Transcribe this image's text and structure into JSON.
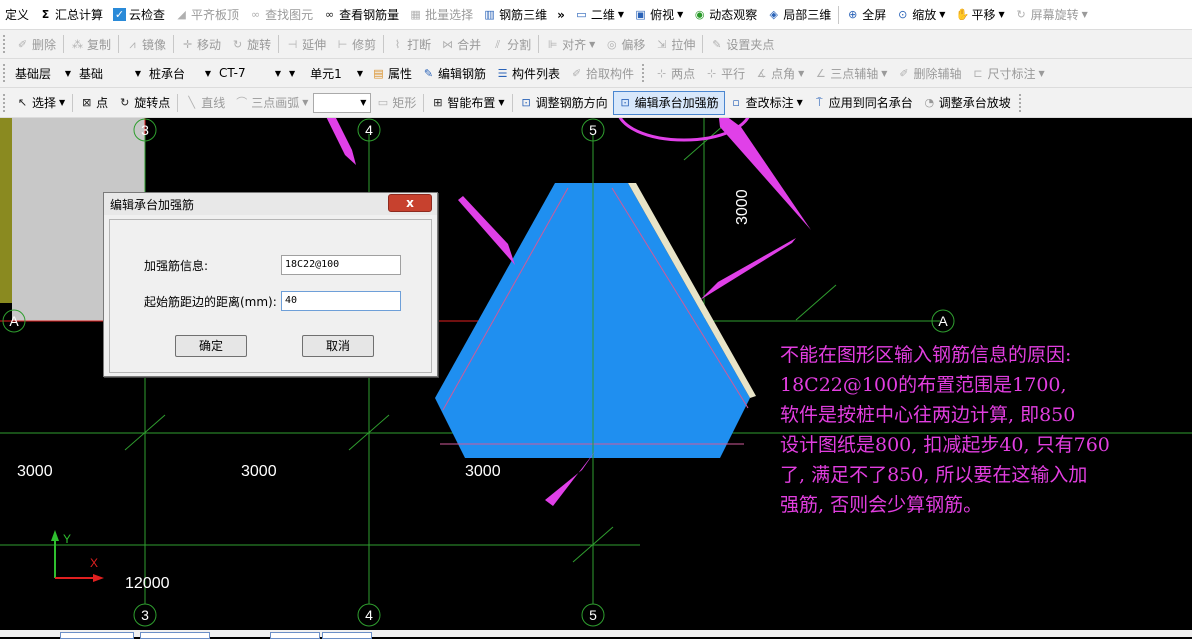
{
  "toolbar1": {
    "define": "定义",
    "sum_calc": "汇总计算",
    "cloud_check": "云检查",
    "flush_slab": "平齐板顶",
    "find_elem": "查找图元",
    "view_rebar_qty": "查看钢筋量",
    "batch_select": "批量选择",
    "rebar_3d": "钢筋三维",
    "more": "»",
    "view_2d": "二维",
    "view_top": "俯视",
    "dynamic_view": "动态观察",
    "local_3d": "局部三维",
    "fullscreen": "全屏",
    "zoom": "缩放",
    "pan": "平移",
    "screen_rotate": "屏幕旋转"
  },
  "toolbar2": {
    "delete": "删除",
    "copy": "复制",
    "mirror": "镜像",
    "move": "移动",
    "rotate": "旋转",
    "extend": "延伸",
    "trim": "修剪",
    "break": "打断",
    "merge": "合并",
    "split": "分割",
    "align": "对齐",
    "offset": "偏移",
    "stretch": "拉伸",
    "set_grip": "设置夹点"
  },
  "toolbar3": {
    "layer": "基础层",
    "category": "基础",
    "type": "桩承台",
    "name": "CT-7",
    "unit": "单元1",
    "property": "属性",
    "edit_rebar": "编辑钢筋",
    "component_list": "构件列表",
    "pick_component": "拾取构件",
    "two_points": "两点",
    "parallel": "平行",
    "point_angle": "点角",
    "three_point_axis": "三点辅轴",
    "delete_axis": "删除辅轴",
    "dimension": "尺寸标注"
  },
  "toolbar4": {
    "select": "选择",
    "point": "点",
    "rotate_point": "旋转点",
    "line": "直线",
    "arc3": "三点画弧",
    "rect": "矩形",
    "smart_layout": "智能布置",
    "adjust_rebar_dir": "调整钢筋方向",
    "edit_reinforce": "编辑承台加强筋",
    "modify_label": "查改标注",
    "apply_same_name": "应用到同名承台",
    "adjust_slope": "调整承台放坡"
  },
  "canvas": {
    "axis_labels": {
      "a3": "3",
      "a4": "4",
      "a5": "5",
      "aA": "A"
    },
    "dims": {
      "d1": "3000",
      "d2": "3000",
      "d3": "3000",
      "vert": "3000",
      "total": "12000"
    },
    "coord": {
      "y": "Y",
      "x": "X"
    }
  },
  "dialog": {
    "title": "编辑承台加强筋",
    "close_glyph": "x",
    "rebar_info_label": "加强筋信息:",
    "rebar_info_value": "18C22@100",
    "offset_label": "起始筋距边的距离(mm):",
    "offset_value": "40",
    "ok": "确定",
    "cancel": "取消"
  },
  "annotation": {
    "lines": [
      "不能在图形区输入钢筋信息的原因:",
      "18C22@100的布置范围是1700,",
      "软件是按桩中心往两边计算, 即850",
      "设计图纸是800, 扣减起步40, 只有760",
      "了, 满足不了850, 所以要在这输入加",
      "强筋, 否则会少算钢筋。"
    ]
  },
  "colors": {
    "background": "#000000",
    "cap_fill": "#1f8ff0",
    "grid_line": "#2f9e2f",
    "axis_red": "#e02020",
    "annotation": "#e23ee0",
    "callout": "#e040e8"
  }
}
